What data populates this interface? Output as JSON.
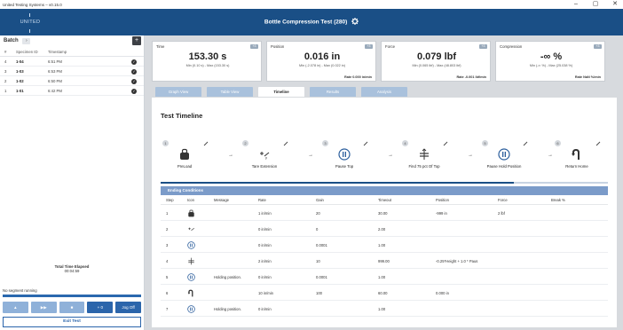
{
  "window": {
    "title": "United Testing Systems – v0.15.0",
    "controls": [
      "–",
      "▢",
      "✕"
    ]
  },
  "app": {
    "brand": "UNITED",
    "title": "Bottle Compression Test (280)"
  },
  "sidebar": {
    "batch_label": "Batch",
    "batch_chip": "›",
    "add_label": "+",
    "headers": [
      "#",
      "Specimen ID",
      "Timestamp"
    ],
    "specimens": [
      {
        "num": "4",
        "id": "1-04",
        "time": "6:51 PM"
      },
      {
        "num": "3",
        "id": "1-03",
        "time": "6:53 PM"
      },
      {
        "num": "2",
        "id": "1-02",
        "time": "6:50 PM"
      },
      {
        "num": "1",
        "id": "1-01",
        "time": "6:42 PM"
      }
    ],
    "check_glyph": "✓",
    "elapsed_label": "Total Time Elapsed",
    "elapsed_value": "00:04:59",
    "no_segment": "No segment running",
    "controls": [
      "▲",
      "▶▶",
      "■",
      "+ 0",
      "Jog Off"
    ],
    "exit_label": "Exit Test"
  },
  "stats": [
    {
      "label": "Time",
      "tag": "+3",
      "value": "153.30 s",
      "minmax": "Min (0.10 s) - Max (153.30 s)",
      "rate": ""
    },
    {
      "label": "Position",
      "tag": "+3",
      "value": "0.016 in",
      "minmax": "Min (-2.078 in) - Max (0.022 in)",
      "rate": "Rate 0.000 in/min"
    },
    {
      "label": "Force",
      "tag": "+3",
      "value": "0.079 lbf",
      "minmax": "Min (0.065 lbf) - Max (48.803 lbf)",
      "rate": "Rate -0.001 lbf/min"
    },
    {
      "label": "Compression",
      "tag": "+3",
      "value": "-∞ %",
      "minmax": "Min (-∞ %) - Max (25.038 %)",
      "rate": "Rate NaN %/min"
    }
  ],
  "tabs": [
    "Graph View",
    "Table View",
    "Timeline",
    "Results",
    "Analysis"
  ],
  "active_tab": 2,
  "timeline": {
    "title": "Test Timeline",
    "progress": 0.79,
    "steps": [
      {
        "num": "1",
        "label": "PreLoad",
        "icon": "weight-icon"
      },
      {
        "num": "2",
        "label": "Tare Extension",
        "icon": "tare-icon"
      },
      {
        "num": "3",
        "label": "Pause Top",
        "icon": "pause-icon"
      },
      {
        "num": "4",
        "label": "Find 75 pct Of Top",
        "icon": "find-position-icon"
      },
      {
        "num": "5",
        "label": "Pause Hold Position",
        "icon": "pause-icon"
      },
      {
        "num": "6",
        "label": "Return Home",
        "icon": "return-home-icon"
      }
    ],
    "arrow_glyph": "→"
  },
  "ending": {
    "title": "Ending Conditions",
    "columns": [
      "Step",
      "Icon",
      "Message",
      "Rate",
      "Gain",
      "Timeout",
      "Position",
      "Force",
      "Break %"
    ],
    "rows": [
      {
        "step": "1",
        "icon": "weight-icon",
        "message": "",
        "rate": "1 in/min",
        "gain": "20",
        "timeout": "30.00",
        "position": "-999 in",
        "force": "2 lbf",
        "break": ""
      },
      {
        "step": "2",
        "icon": "tare-icon",
        "message": "",
        "rate": "0 in/min",
        "gain": "0",
        "timeout": "2.00",
        "position": "",
        "force": "",
        "break": ""
      },
      {
        "step": "3",
        "icon": "pause-icon",
        "message": "",
        "rate": "0 in/min",
        "gain": "0.0001",
        "timeout": "1.00",
        "position": "",
        "force": "",
        "break": ""
      },
      {
        "step": "4",
        "icon": "find-position-icon",
        "message": "",
        "rate": "2 in/min",
        "gain": "10",
        "timeout": "999.00",
        "position": "-0.25*Height + 1.0 * Paus",
        "force": "",
        "break": ""
      },
      {
        "step": "5",
        "icon": "pause-icon",
        "message": "Holding position.",
        "rate": "0 in/min",
        "gain": "0.0001",
        "timeout": "1.00",
        "position": "",
        "force": "",
        "break": ""
      },
      {
        "step": "6",
        "icon": "return-home-icon",
        "message": "",
        "rate": "10 in/min",
        "gain": "100",
        "timeout": "60.00",
        "position": "0.000 in",
        "force": "",
        "break": ""
      },
      {
        "step": "7",
        "icon": "pause-icon",
        "message": "Holding position.",
        "rate": "0 in/min",
        "gain": "",
        "timeout": "1.00",
        "position": "",
        "force": "",
        "break": ""
      }
    ]
  }
}
